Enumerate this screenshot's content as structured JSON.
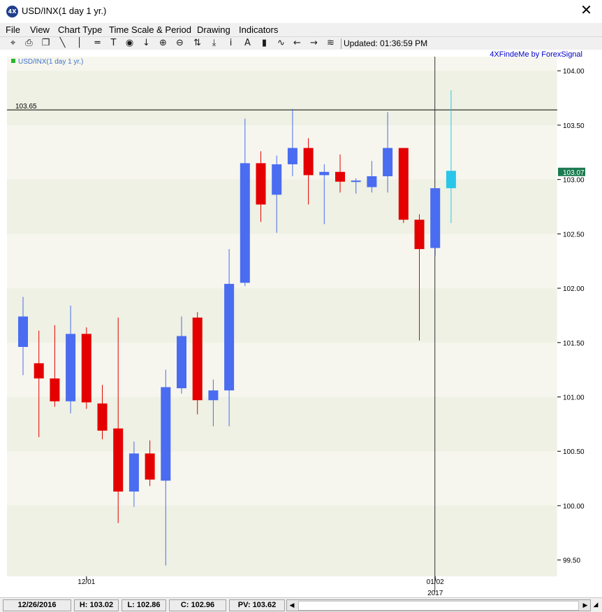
{
  "window": {
    "title": "USD/INX(1 day  1 yr.)",
    "icon_label": "4X",
    "close_glyph": "✕",
    "mdi_min_glyph": "_",
    "mdi_close_glyph": "✕"
  },
  "menu": {
    "items": [
      "File",
      "View",
      "Chart Type",
      "Time Scale & Period",
      "Drawing",
      "Indicators"
    ]
  },
  "toolbar": {
    "buttons": [
      {
        "name": "crosshair-icon",
        "glyph": "⌖"
      },
      {
        "name": "print-icon",
        "glyph": "⎙"
      },
      {
        "name": "copy-icon",
        "glyph": "❐"
      },
      {
        "name": "trendline-icon",
        "glyph": "╲"
      },
      {
        "name": "vertical-line-icon",
        "glyph": "│"
      },
      {
        "name": "horizontal-line-icon",
        "glyph": "═"
      },
      {
        "name": "text-icon",
        "glyph": "T"
      },
      {
        "name": "target-icon",
        "glyph": "◉"
      },
      {
        "name": "arrow-down-icon",
        "glyph": "↓"
      },
      {
        "name": "zoom-in-icon",
        "glyph": "⊕"
      },
      {
        "name": "zoom-out-icon",
        "glyph": "⊖"
      },
      {
        "name": "fit-icon",
        "glyph": "⇅"
      },
      {
        "name": "download-icon",
        "glyph": "⤓"
      },
      {
        "name": "info-icon",
        "glyph": "i"
      },
      {
        "name": "fibonacci-icon",
        "glyph": "A"
      },
      {
        "name": "bar-chart-icon",
        "glyph": "▮"
      },
      {
        "name": "indicator-icon",
        "glyph": "∿"
      },
      {
        "name": "scroll-left-icon",
        "glyph": "←"
      },
      {
        "name": "scroll-right-icon",
        "glyph": "→"
      },
      {
        "name": "waves-icon",
        "glyph": "≋"
      }
    ],
    "updated_text": "Updated: 01:36:59 PM"
  },
  "chart_data": {
    "type": "candlestick",
    "legend_label": "USD/INX(1 day  1 yr.)",
    "watermark": "4XFindeMe by ForexSignal",
    "y_ticks": [
      "104.00",
      "103.50",
      "103.00",
      "102.50",
      "102.00",
      "101.50",
      "101.00",
      "100.50",
      "100.00",
      "99.50"
    ],
    "y_tick_values": [
      104.0,
      103.5,
      103.0,
      102.5,
      102.0,
      101.5,
      101.0,
      100.5,
      100.0,
      99.5
    ],
    "ylim": [
      99.35,
      104.13
    ],
    "x_labels": [
      {
        "index": 4,
        "date": "12/01",
        "year": ""
      },
      {
        "index": 26,
        "date": "01/02",
        "year": "2017"
      }
    ],
    "horizontal_line": {
      "value": 103.64,
      "label": "103.65"
    },
    "vertical_line_index": 26,
    "current_price": {
      "label": "103.07",
      "value": 103.07
    },
    "candles": [
      {
        "o": 101.46,
        "h": 101.92,
        "l": 101.2,
        "c": 101.74
      },
      {
        "o": 101.31,
        "h": 101.61,
        "l": 100.63,
        "c": 101.17
      },
      {
        "o": 101.17,
        "h": 101.66,
        "l": 100.91,
        "c": 100.96
      },
      {
        "o": 100.96,
        "h": 101.84,
        "l": 100.85,
        "c": 101.58
      },
      {
        "o": 101.58,
        "h": 101.64,
        "l": 100.89,
        "c": 100.95
      },
      {
        "o": 100.94,
        "h": 101.11,
        "l": 100.61,
        "c": 100.69
      },
      {
        "o": 100.71,
        "h": 101.73,
        "l": 99.84,
        "c": 100.13
      },
      {
        "o": 100.13,
        "h": 100.59,
        "l": 99.99,
        "c": 100.48
      },
      {
        "o": 100.48,
        "h": 100.6,
        "l": 100.18,
        "c": 100.24
      },
      {
        "o": 100.23,
        "h": 101.25,
        "l": 99.45,
        "c": 101.09
      },
      {
        "o": 101.08,
        "h": 101.74,
        "l": 101.03,
        "c": 101.56
      },
      {
        "o": 101.73,
        "h": 101.78,
        "l": 100.84,
        "c": 100.97
      },
      {
        "o": 100.97,
        "h": 101.16,
        "l": 100.73,
        "c": 101.06
      },
      {
        "o": 101.06,
        "h": 102.36,
        "l": 100.73,
        "c": 102.04
      },
      {
        "o": 102.05,
        "h": 103.56,
        "l": 102.02,
        "c": 103.15
      },
      {
        "o": 103.15,
        "h": 103.26,
        "l": 102.61,
        "c": 102.77
      },
      {
        "o": 102.86,
        "h": 103.22,
        "l": 102.51,
        "c": 103.14
      },
      {
        "o": 103.14,
        "h": 103.65,
        "l": 103.03,
        "c": 103.29
      },
      {
        "o": 103.29,
        "h": 103.38,
        "l": 102.77,
        "c": 103.04
      },
      {
        "o": 103.04,
        "h": 103.14,
        "l": 102.59,
        "c": 103.07
      },
      {
        "o": 103.07,
        "h": 103.23,
        "l": 102.88,
        "c": 102.98
      },
      {
        "o": 102.98,
        "h": 103.01,
        "l": 102.87,
        "c": 102.99
      },
      {
        "o": 102.93,
        "h": 103.17,
        "l": 102.88,
        "c": 103.03
      },
      {
        "o": 103.03,
        "h": 103.62,
        "l": 102.88,
        "c": 103.29
      },
      {
        "o": 103.29,
        "h": 103.29,
        "l": 102.6,
        "c": 102.63
      },
      {
        "o": 102.63,
        "h": 102.68,
        "l": 101.52,
        "c": 102.36
      },
      {
        "o": 102.37,
        "h": 102.92,
        "l": 102.3,
        "c": 102.92
      },
      {
        "o": 102.92,
        "h": 103.82,
        "l": 102.6,
        "c": 103.08
      }
    ]
  },
  "colors": {
    "up": "#4a6cf0",
    "down": "#e40000",
    "current": "#29c6ea",
    "band_a": "#eef1e3",
    "band_b": "#f6f6ee",
    "price_box": "#1b7a4f",
    "watermark": "#0000c8",
    "legend_text": "#3f73cc",
    "legend_square": "#2ab52a"
  },
  "status": {
    "date": "12/26/2016",
    "high": "H: 103.02",
    "low": "L: 102.86",
    "close": "C: 102.96",
    "pv": "PV: 103.62"
  }
}
